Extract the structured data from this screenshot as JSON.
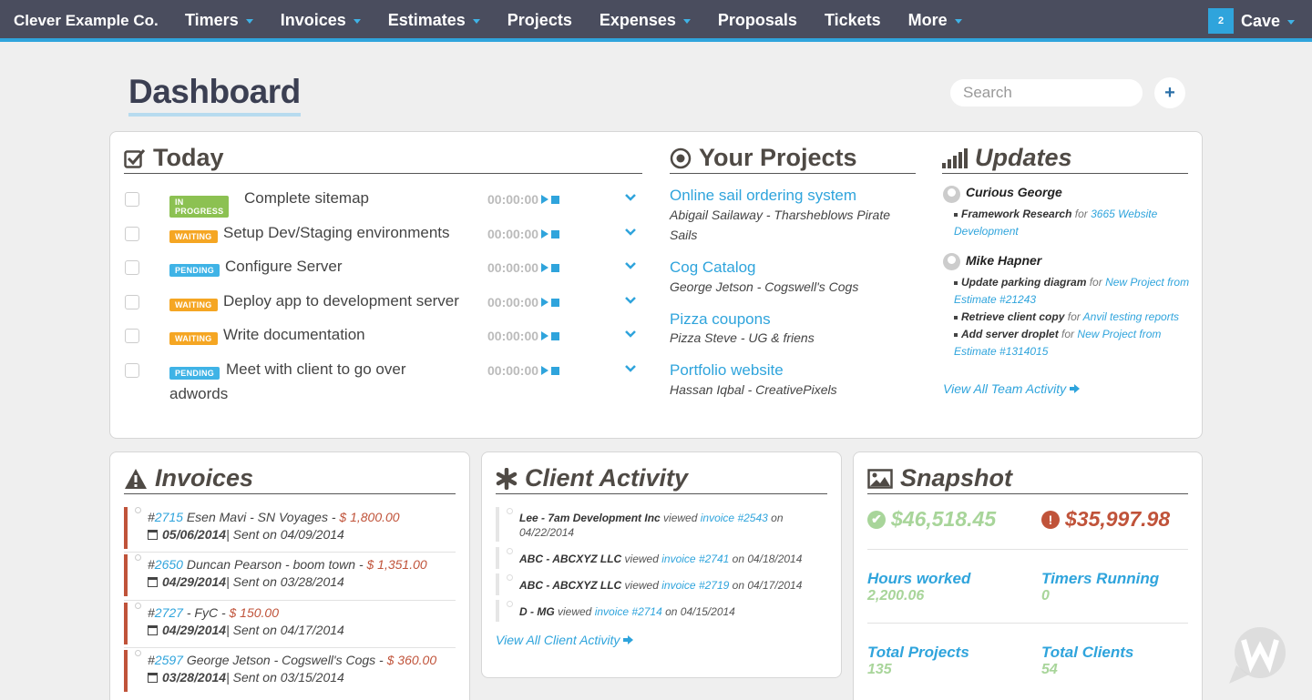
{
  "nav": {
    "brand": "Clever Example Co.",
    "menu": [
      {
        "label": "Timers",
        "dropdown": true
      },
      {
        "label": "Invoices",
        "dropdown": true
      },
      {
        "label": "Estimates",
        "dropdown": true
      },
      {
        "label": "Projects",
        "dropdown": false
      },
      {
        "label": "Expenses",
        "dropdown": true
      },
      {
        "label": "Proposals",
        "dropdown": false
      },
      {
        "label": "Tickets",
        "dropdown": false
      },
      {
        "label": "More",
        "dropdown": true
      }
    ],
    "user_badge": "2",
    "user_name": "Cave"
  },
  "header": {
    "title": "Dashboard",
    "search_placeholder": "Search",
    "add_label": "+"
  },
  "today": {
    "title": "Today",
    "tasks": [
      {
        "status": "IN PROGRESS",
        "status_color": "#8cc152",
        "name": "Complete sitemap",
        "timer": "00:00:00"
      },
      {
        "status": "WAITING",
        "status_color": "#f5a623",
        "name": "Setup Dev/Staging environments",
        "timer": "00:00:00"
      },
      {
        "status": "PENDING",
        "status_color": "#3fb3e6",
        "name": "Configure Server",
        "timer": "00:00:00"
      },
      {
        "status": "WAITING",
        "status_color": "#f5a623",
        "name": "Deploy app to development server",
        "timer": "00:00:00"
      },
      {
        "status": "WAITING",
        "status_color": "#f5a623",
        "name": "Write documentation",
        "timer": "00:00:00"
      },
      {
        "status": "PENDING",
        "status_color": "#3fb3e6",
        "name": "Meet with client to go over",
        "name_cont": "adwords",
        "timer": "00:00:00"
      }
    ]
  },
  "projects": {
    "title": "Your Projects",
    "items": [
      {
        "name": "Online sail ordering system",
        "client": "Abigail Sailaway - Tharsheblows Pirate Sails"
      },
      {
        "name": "Cog Catalog",
        "client": "George Jetson - Cogswell's Cogs"
      },
      {
        "name": "Pizza coupons",
        "client": "Pizza Steve - UG & friens"
      },
      {
        "name": "Portfolio website",
        "client": "Hassan Iqbal - CreativePixels"
      }
    ]
  },
  "updates": {
    "title": "Updates",
    "people": [
      {
        "name": "Curious George",
        "items": [
          {
            "action": "Framework Research",
            "for": "for",
            "target": "3665 Website Development"
          }
        ]
      },
      {
        "name": "Mike Hapner",
        "items": [
          {
            "action": "Update parking diagram",
            "for": "for",
            "target": "New Project from Estimate #21243"
          },
          {
            "action": "Retrieve client copy",
            "for": "for",
            "target": "Anvil testing reports"
          },
          {
            "action": "Add server droplet",
            "for": "for",
            "target": "New Project from Estimate #1314015"
          }
        ]
      }
    ],
    "view_all": "View All Team Activity"
  },
  "invoices": {
    "title": "Invoices",
    "items": [
      {
        "hash": "#",
        "number": "2715",
        "desc": " Esen Mavi - SN Voyages - ",
        "amount": "$ 1,800.00",
        "due": "05/06/2014",
        "sent": " | Sent on 04/09/2014"
      },
      {
        "hash": "#",
        "number": "2650",
        "desc": " Duncan Pearson - boom town - ",
        "amount": "$ 1,351.00",
        "due": "04/29/2014",
        "sent": " | Sent on 03/28/2014"
      },
      {
        "hash": "#",
        "number": "2727",
        "desc": " - FyC - ",
        "amount": "$ 150.00",
        "due": "04/29/2014",
        "sent": " | Sent on 04/17/2014"
      },
      {
        "hash": "#",
        "number": "2597",
        "desc": " George Jetson - Cogswell's Cogs - ",
        "amount": "$ 360.00",
        "due": "03/28/2014",
        "sent": " | Sent on 03/15/2014"
      }
    ]
  },
  "client_activity": {
    "title": "Client Activity",
    "items": [
      {
        "who": "Lee - 7am Development Inc",
        "verb": " viewed ",
        "target": "invoice #2543",
        "when": " on 04/22/2014"
      },
      {
        "who": "ABC - ABCXYZ LLC",
        "verb": " viewed ",
        "target": "invoice #2741",
        "when": " on 04/18/2014"
      },
      {
        "who": "ABC - ABCXYZ LLC",
        "verb": " viewed ",
        "target": "invoice #2719",
        "when": " on 04/17/2014"
      },
      {
        "who": "D - MG",
        "verb": " viewed ",
        "target": "invoice #2714",
        "when": " on 04/15/2014"
      }
    ],
    "view_all": "View All Client Activity"
  },
  "snapshot": {
    "title": "Snapshot",
    "paid": "$46,518.45",
    "outstanding": "$35,997.98",
    "paid_color": "#a8d59a",
    "outstanding_color": "#c0533a",
    "stats": [
      {
        "label": "Hours worked",
        "value": "2,200.06"
      },
      {
        "label": "Timers Running",
        "value": "0"
      },
      {
        "label": "Total Projects",
        "value": "135"
      },
      {
        "label": "Total Clients",
        "value": "54"
      }
    ]
  }
}
